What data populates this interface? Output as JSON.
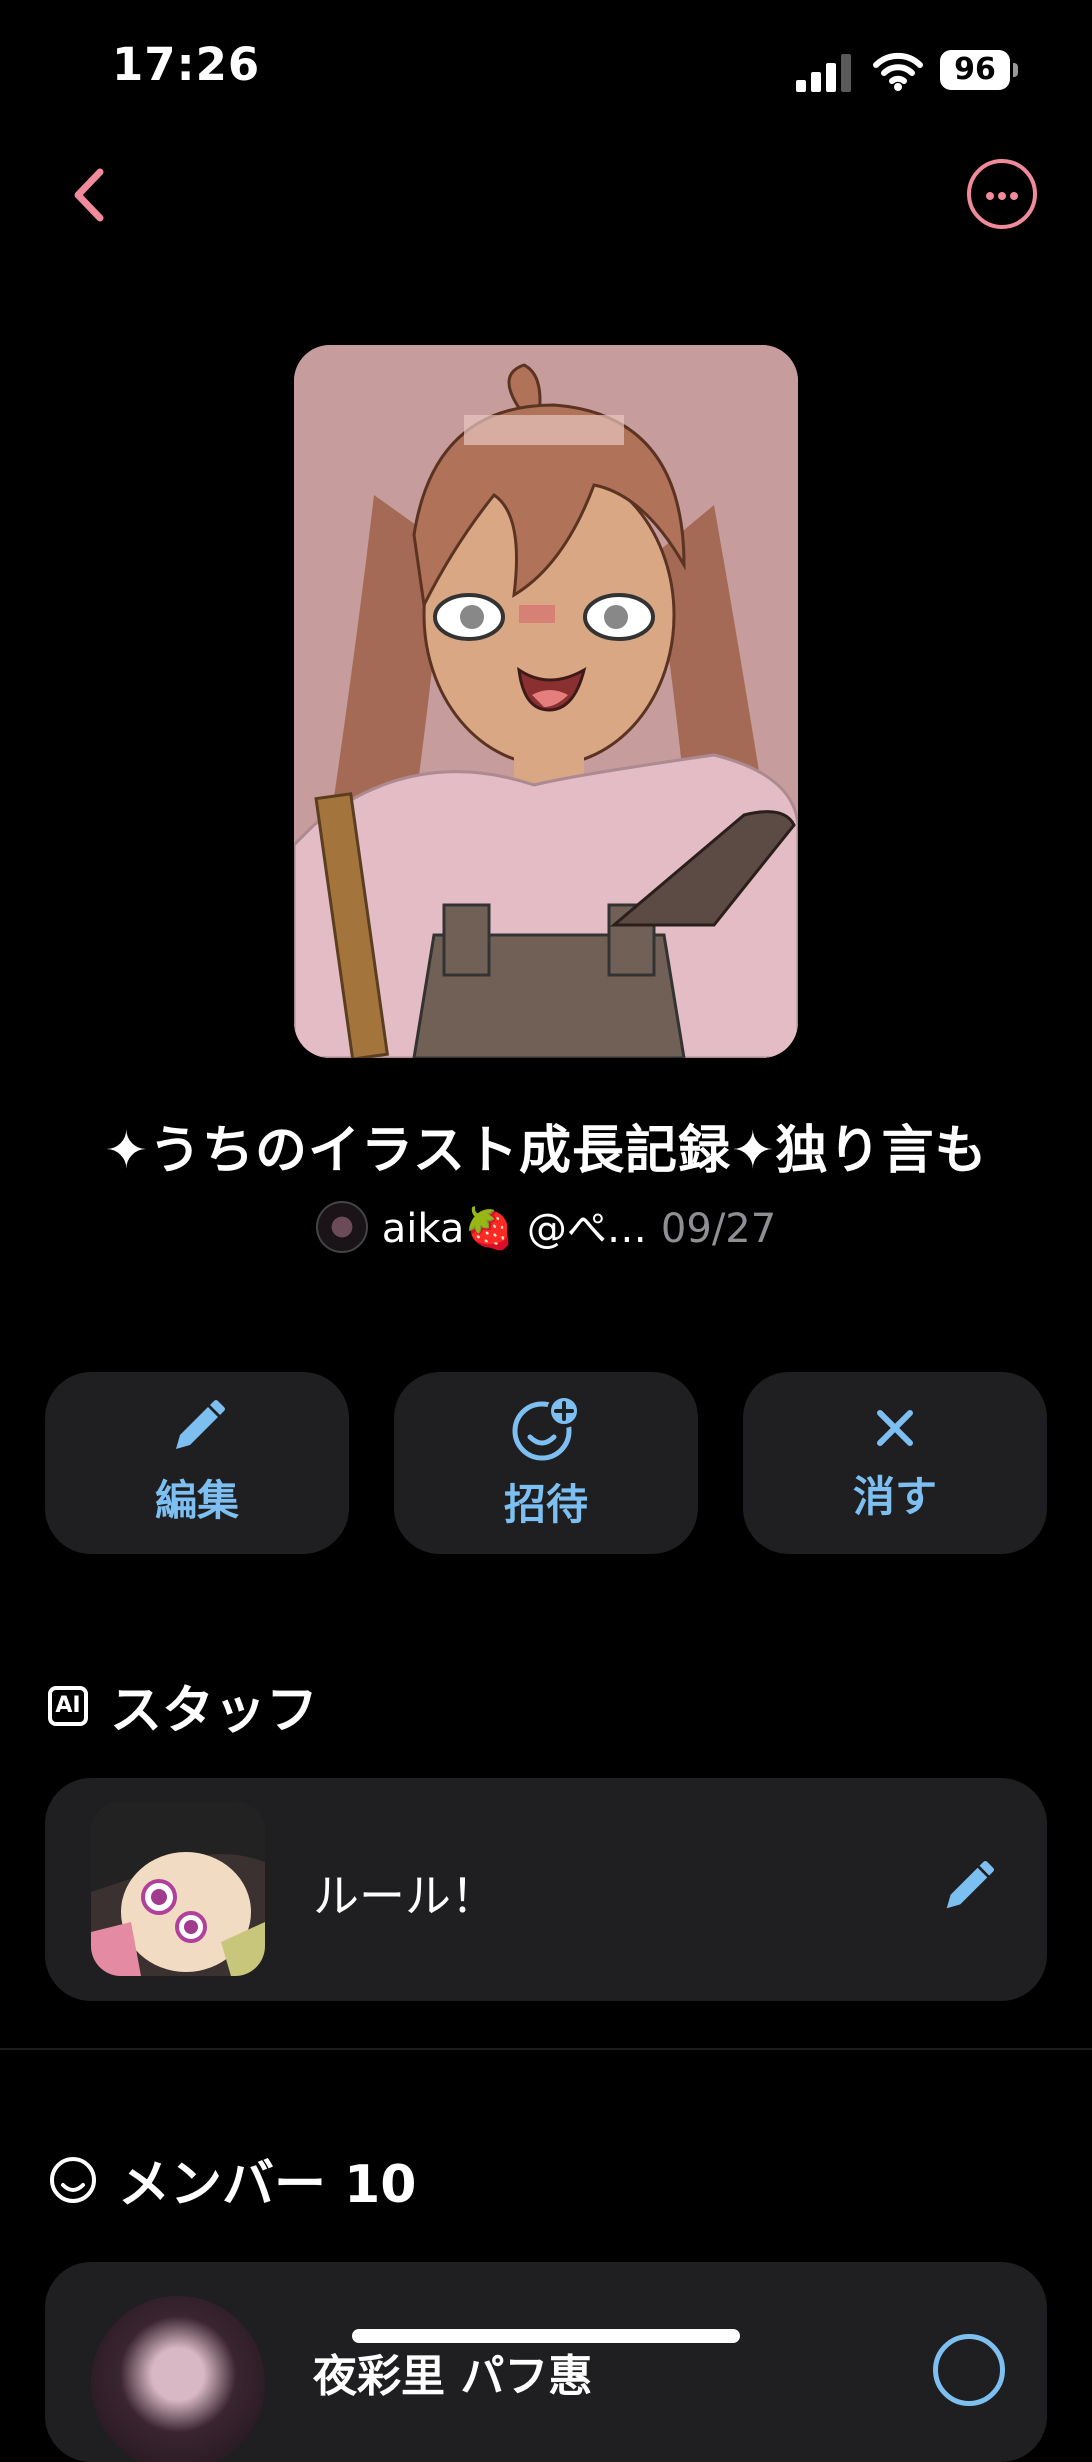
{
  "status_bar": {
    "time": "17:26",
    "battery": "96"
  },
  "circle": {
    "title": "✦うちのイラスト成長記録✦独り言も",
    "owner": "aika🍓 @ぺ…",
    "date": "09/27"
  },
  "actions": [
    {
      "label": "編集",
      "icon": "pencil-icon"
    },
    {
      "label": "招待",
      "icon": "add-person-icon"
    },
    {
      "label": "消す",
      "icon": "close-icon"
    }
  ],
  "staff": {
    "section_label": "スタッフ",
    "badge": "AI",
    "item_label": "ルール！"
  },
  "members": {
    "section_label": "メンバー 10",
    "first_member_name": "夜彩里 パフ惠"
  },
  "colors": {
    "accent_pink": "#f18a9b",
    "accent_blue": "#7cbff0",
    "card_bg": "#1f1f21"
  }
}
